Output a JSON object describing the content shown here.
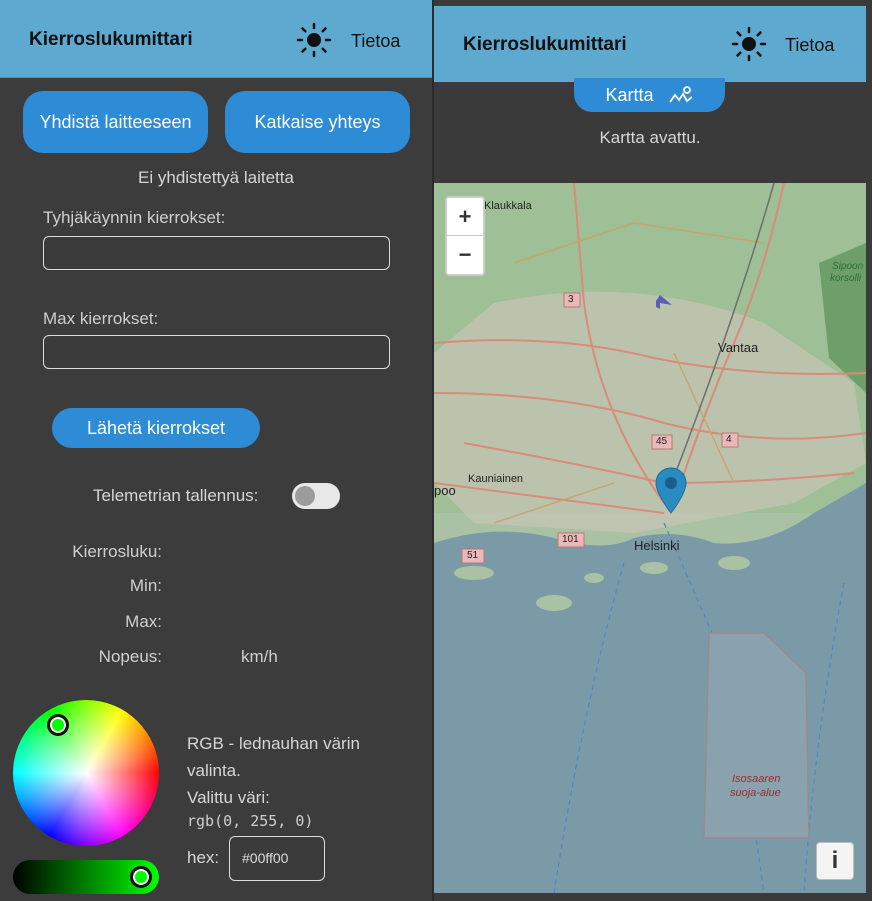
{
  "left_panel": {
    "header": {
      "title": "Kierroslukumittari",
      "about": "Tietoa"
    },
    "connect_button": "Yhdistä laitteeseen",
    "disconnect_button": "Katkaise yhteys",
    "connection_status": "Ei yhdistettyä laitetta",
    "idle_rpm_label": "Tyhjäkäynnin kierrokset:",
    "idle_rpm_value": "",
    "max_rpm_label": "Max kierrokset:",
    "max_rpm_value": "",
    "send_button": "Lähetä kierrokset",
    "telemetry_label": "Telemetrian tallennus:",
    "telemetry_enabled": false,
    "stats": {
      "rpm_label": "Kierrosluku:",
      "min_label": "Min:",
      "max_label": "Max:",
      "speed_label": "Nopeus:",
      "speed_unit": "km/h"
    },
    "color_picker": {
      "description_line1": "RGB - lednauhan värin valinta.",
      "selected_label": "Valittu väri:",
      "rgb_value": "rgb(0, 255, 0)",
      "hex_label": "hex:",
      "hex_value": "#00ff00",
      "selected_color": "#00ff00"
    }
  },
  "right_panel": {
    "header": {
      "title": "Kierroslukumittari",
      "about": "Tietoa"
    },
    "map_button": "Kartta",
    "map_status": "Kartta avattu.",
    "map": {
      "zoom_in": "+",
      "zoom_out": "−",
      "info_button": "i",
      "labels": {
        "klaukkala": "Klaukkala",
        "vantaa": "Vantaa",
        "helsinki": "Helsinki",
        "kauniainen": "Kauniainen",
        "espoo_fragment": "poo",
        "sipoon": "Sipoon",
        "sipoon2": "korsolli",
        "isosaaren": "Isosaaren",
        "suoja_alue": "suoja-alue",
        "road_3": "3",
        "road_45": "45",
        "road_4": "4",
        "road_51": "51",
        "road_101": "101"
      }
    }
  },
  "colors": {
    "header_bg": "#5ea9d0",
    "button_bg": "#2e8bd6",
    "panel_bg": "#3c3c3c",
    "marker": "#2a8ac2"
  }
}
